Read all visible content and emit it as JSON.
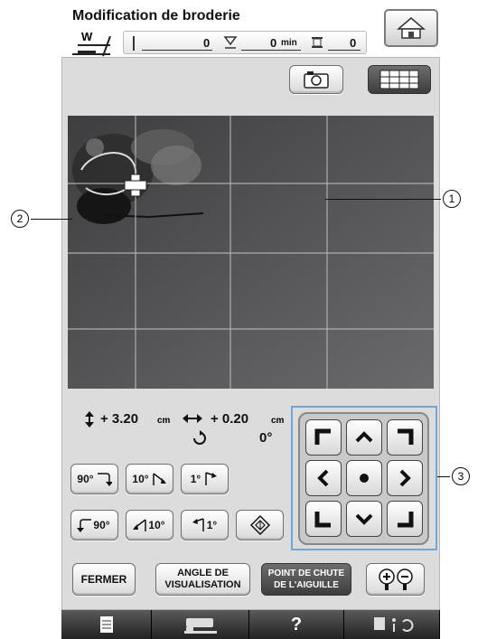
{
  "header": {
    "title": "Modification de broderie",
    "needle_label": "W",
    "stitch_count": "0",
    "time_value": "0",
    "time_unit": "min",
    "thread_count": "0"
  },
  "toolbar": {
    "home_icon": "home-icon",
    "camera_icon": "camera-icon",
    "grid_icon": "grid-icon"
  },
  "readouts": {
    "vertical": "+ 3.20",
    "vertical_unit": "cm",
    "horizontal": "+ 0.20",
    "horizontal_unit": "cm",
    "angle": "0°"
  },
  "rotate_buttons": {
    "cw90": "90°",
    "cw10": "10°",
    "cw1": "1°",
    "ccw90": "90°",
    "ccw10": "10°",
    "ccw1": "1°"
  },
  "bottom_buttons": {
    "close": "FERMER",
    "view_angle_1": "ANGLE DE",
    "view_angle_2": "VISUALISATION",
    "needle_drop_1": "POINT DE CHUTE",
    "needle_drop_2": "DE L'AIGUILLE"
  },
  "footer": {
    "help": "?"
  },
  "callouts": {
    "one": "1",
    "two": "2",
    "three": "3"
  }
}
